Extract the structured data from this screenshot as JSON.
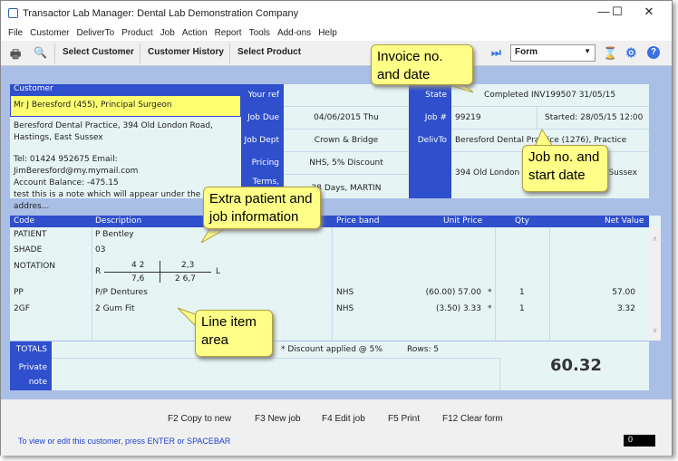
{
  "window": {
    "title": "Transactor Lab Manager:  Dental Lab Demonstration Company",
    "controls": [
      "—",
      "☐",
      "✕"
    ]
  },
  "menu": [
    "File",
    "Customer",
    "DeliverTo",
    "Product",
    "Job",
    "Action",
    "Report",
    "Tools",
    "Add-ons",
    "Help"
  ],
  "toolbar": {
    "select_customer": "Select Customer",
    "customer_history": "Customer History",
    "select_product": "Select Product",
    "view_select": "Form"
  },
  "customer": {
    "header": "Customer",
    "name": "Mr J Beresford (455), Principal Surgeon",
    "address1": "Beresford Dental Practice, 394 Old London Road,",
    "address2": "Hastings, East Sussex",
    "contact": "Tel: 01424 952675  Email: JimBeresford@my.mymail.com",
    "balance": "Account Balance: -475.15",
    "note": "test this is a note which will appear under the addres..."
  },
  "job": {
    "labels": {
      "your_ref": "Your ref",
      "job_due": "Job Due",
      "job_dept": "Job Dept",
      "pricing": "Pricing",
      "terms": "Terms,",
      "state": "State",
      "job_no": "Job #",
      "deliv_to": "DelivTo"
    },
    "your_ref": "",
    "job_due": "04/06/2015  Thu",
    "job_dept": "Crown & Bridge",
    "pricing": "NHS, 5% Discount",
    "terms": "28 Days, MARTIN",
    "state": "Completed   INV199507  31/05/15",
    "job_no": "99219",
    "started": "Started:  28/05/15  12:00",
    "deliv_to": "Beresford Dental Practice (1276), Practice",
    "deliv_address": "394 Old London Road, Hastings, East Sussex"
  },
  "lines": {
    "headers": [
      "Code",
      "Description",
      "Price band",
      "Unit Price",
      "Qty",
      "Net Value"
    ],
    "info_rows": [
      {
        "code": "PATIENT",
        "desc": "P Bentley"
      },
      {
        "code": "SHADE",
        "desc": "03"
      },
      {
        "code": "NOTATION",
        "desc": ""
      }
    ],
    "notation": {
      "r": "R",
      "l": "L",
      "ur": "4 2",
      "ul": "2,3",
      "lr": "7,6",
      "ll": "2  6,7"
    },
    "items": [
      {
        "code": "PP",
        "desc": "P/P Dentures",
        "band": "NHS",
        "unit": "(60.00)  57.00",
        "flag": "*",
        "qty": "1",
        "net": "57.00"
      },
      {
        "code": "2GF",
        "desc": "2 Gum Fit",
        "band": "NHS",
        "unit": "(3.50)  3.33",
        "flag": "*",
        "qty": "1",
        "net": "3.32"
      }
    ]
  },
  "totals": {
    "label": "TOTALS",
    "discount": "* Discount applied @ 5%",
    "rows": "Rows:  5",
    "note_label1": "Private",
    "note_label2": "note",
    "total": "60.32"
  },
  "footer": {
    "keys": [
      "F2 Copy to new",
      "F3 New job",
      "F4 Edit job",
      "F5 Print",
      "F12 Clear form"
    ],
    "status": "To view or edit this customer, press ENTER or SPACEBAR",
    "counter": "0"
  },
  "callouts": {
    "invoice": [
      "Invoice no.",
      "and date"
    ],
    "job": [
      "Job no. and",
      "start date"
    ],
    "extra": [
      "Extra patient and",
      "job information"
    ],
    "lines": [
      "Line item",
      "area"
    ]
  }
}
